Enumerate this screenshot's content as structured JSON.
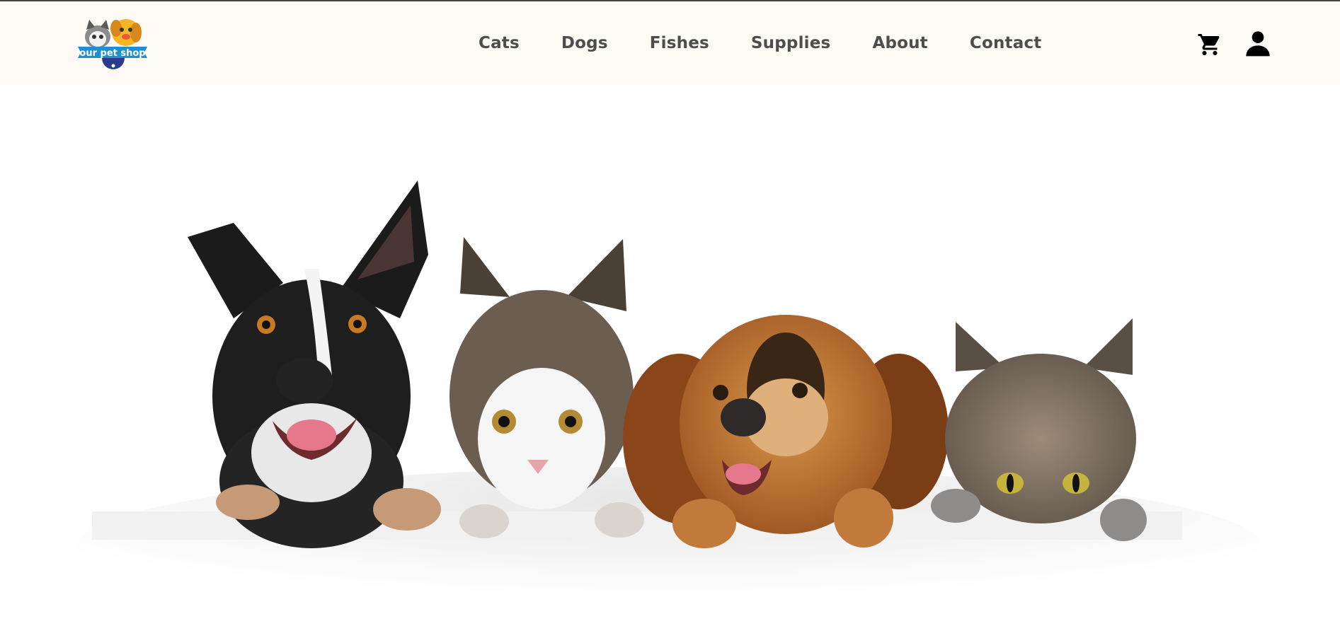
{
  "brand": {
    "logo_text": "our pet shop",
    "logo_icon": "pet-shop-logo"
  },
  "nav": {
    "items": [
      "Cats",
      "Dogs",
      "Fishes",
      "Supplies",
      "About",
      "Contact"
    ]
  },
  "actions": {
    "cart_icon": "cart-icon",
    "user_icon": "user-icon"
  },
  "hero": {
    "image_icon": "pets-peeking-over-ledge-illustration"
  },
  "colors": {
    "header_bg": "#fdf9f4",
    "nav_text": "#4d4d4d",
    "icon": "#000000"
  }
}
